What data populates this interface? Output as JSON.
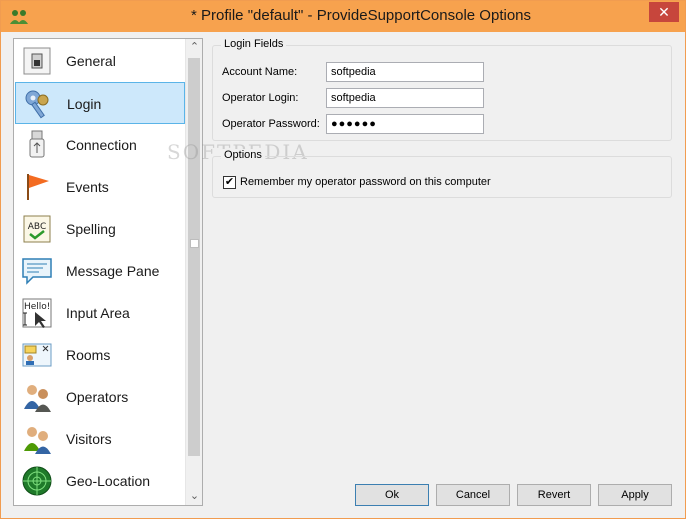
{
  "window": {
    "title": "* Profile \"default\" - ProvideSupportConsole Options",
    "close_glyph": "✕",
    "accent_color": "#f7a24e"
  },
  "sidebar": {
    "items": [
      {
        "label": "General",
        "icon": "switch-icon"
      },
      {
        "label": "Login",
        "icon": "keys-icon"
      },
      {
        "label": "Connection",
        "icon": "usb-plug-icon"
      },
      {
        "label": "Events",
        "icon": "flag-icon"
      },
      {
        "label": "Spelling",
        "icon": "abc-spellcheck-icon"
      },
      {
        "label": "Message Pane",
        "icon": "chat-bubble-icon"
      },
      {
        "label": "Input Area",
        "icon": "hello-text-icon"
      },
      {
        "label": "Rooms",
        "icon": "rooms-icon"
      },
      {
        "label": "Operators",
        "icon": "operators-icon"
      },
      {
        "label": "Visitors",
        "icon": "visitors-icon"
      },
      {
        "label": "Geo-Location",
        "icon": "globe-radar-icon"
      }
    ],
    "selected": "Login",
    "icon_hello_text": "Hello!",
    "icon_abc_text": "ABC"
  },
  "login_fields": {
    "legend": "Login Fields",
    "account_name_label": "Account Name:",
    "account_name_value": "softpedia",
    "operator_login_label": "Operator Login:",
    "operator_login_value": "softpedia",
    "operator_password_label": "Operator Password:",
    "operator_password_value": "●●●●●●"
  },
  "options": {
    "legend": "Options",
    "remember_password_label": "Remember my operator password on this computer",
    "remember_password_checked": true,
    "check_glyph": "✔"
  },
  "buttons": {
    "ok": "Ok",
    "cancel": "Cancel",
    "revert": "Revert",
    "apply": "Apply"
  },
  "watermark": "SOFTPEDIA"
}
